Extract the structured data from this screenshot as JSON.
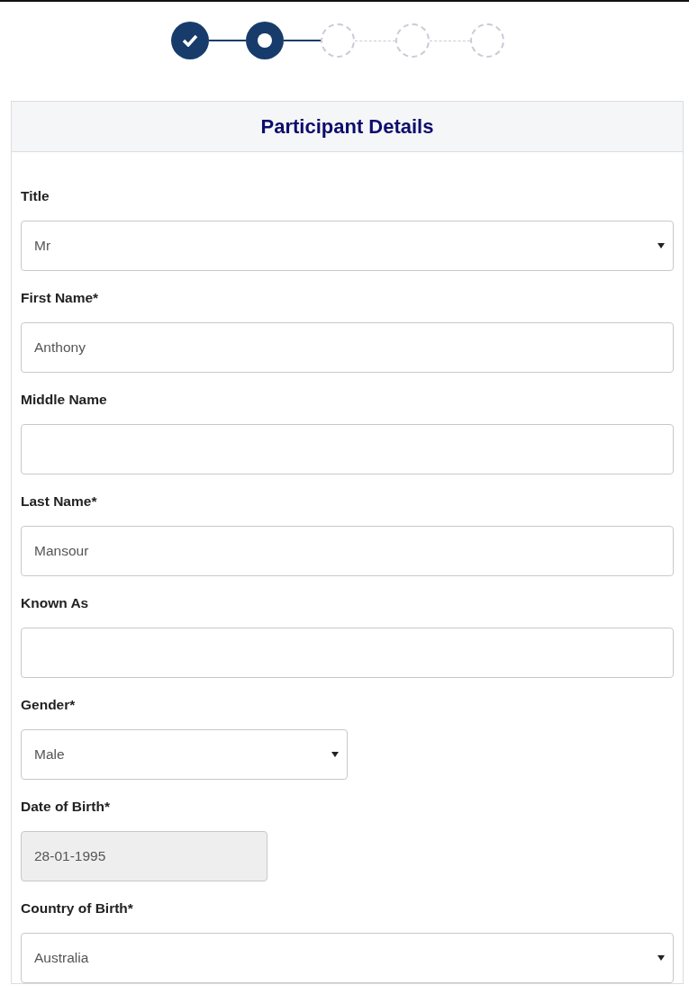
{
  "stepper": [
    {
      "completed": true,
      "selected": false
    },
    {
      "completed": false,
      "selected": true
    },
    {
      "completed": false,
      "selected": false
    },
    {
      "completed": false,
      "selected": false
    },
    {
      "completed": false,
      "selected": false
    }
  ],
  "card": {
    "title": "Participant Details"
  },
  "fields": [
    {
      "label": "Title",
      "kind": "select",
      "value": "Mr"
    },
    {
      "label": "First Name*",
      "kind": "text",
      "value": "Anthony"
    },
    {
      "label": "Middle Name",
      "kind": "text"
    },
    {
      "label": "Last Name*",
      "kind": "text",
      "value": "Mansour"
    },
    {
      "label": "Known As",
      "kind": "text"
    },
    {
      "label": "Gender*",
      "kind": "short-select",
      "value": "Male"
    },
    {
      "label": "Date of Birth*",
      "kind": "date",
      "value": "28-01-1995",
      "disabled": true
    },
    {
      "label": "Country of Birth*",
      "kind": "select",
      "value": "Australia"
    }
  ]
}
